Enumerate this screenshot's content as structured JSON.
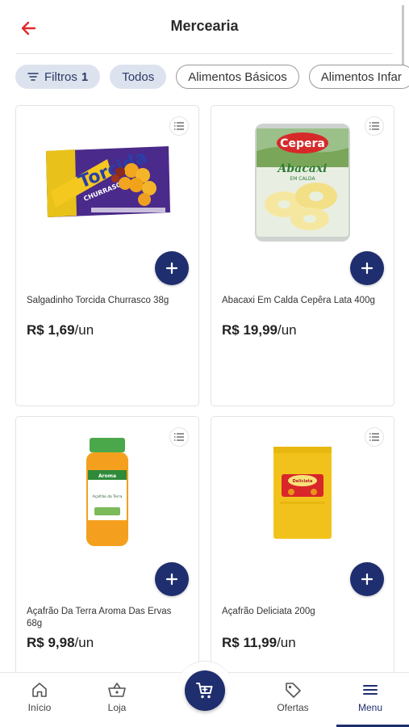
{
  "header": {
    "title": "Mercearia",
    "back_icon": "arrow-left-icon",
    "accent_color": "#e02b2b"
  },
  "filters": {
    "filter_label": "Filtros",
    "filter_count": "1",
    "chips": [
      "Todos",
      "Alimentos Básicos",
      "Alimentos Infar"
    ]
  },
  "products": [
    {
      "name": "Salgadinho Torcida Churrasco 38g",
      "price": "R$ 1,69",
      "unit": "/un",
      "image_brand": "Torcida",
      "image_sub": "CHURRASCO"
    },
    {
      "name": "Abacaxi Em Calda Cepêra Lata 400g",
      "price": "R$ 19,99",
      "unit": "/un",
      "image_brand": "Cepera",
      "image_sub": "Abacaxi",
      "image_sub2": "EM CALDA"
    },
    {
      "name": "Açafrão Da Terra Aroma Das Ervas 68g",
      "price": "R$ 9,98",
      "unit": "/un",
      "image_brand": "Aroma",
      "image_sub": "Açafrão da Terra"
    },
    {
      "name": "Açafrão Deliciata 200g",
      "price": "R$ 11,99",
      "unit": "/un",
      "image_brand": "Deliciata"
    }
  ],
  "bottom_nav": {
    "items": [
      {
        "label": "Início",
        "icon": "home-icon"
      },
      {
        "label": "Loja",
        "icon": "basket-icon"
      },
      {
        "label": "Ofertas",
        "icon": "tag-icon"
      },
      {
        "label": "Menu",
        "icon": "menu-icon"
      }
    ],
    "cart_icon": "cart-icon",
    "active": "Menu",
    "brand_color": "#1f2e6e"
  }
}
